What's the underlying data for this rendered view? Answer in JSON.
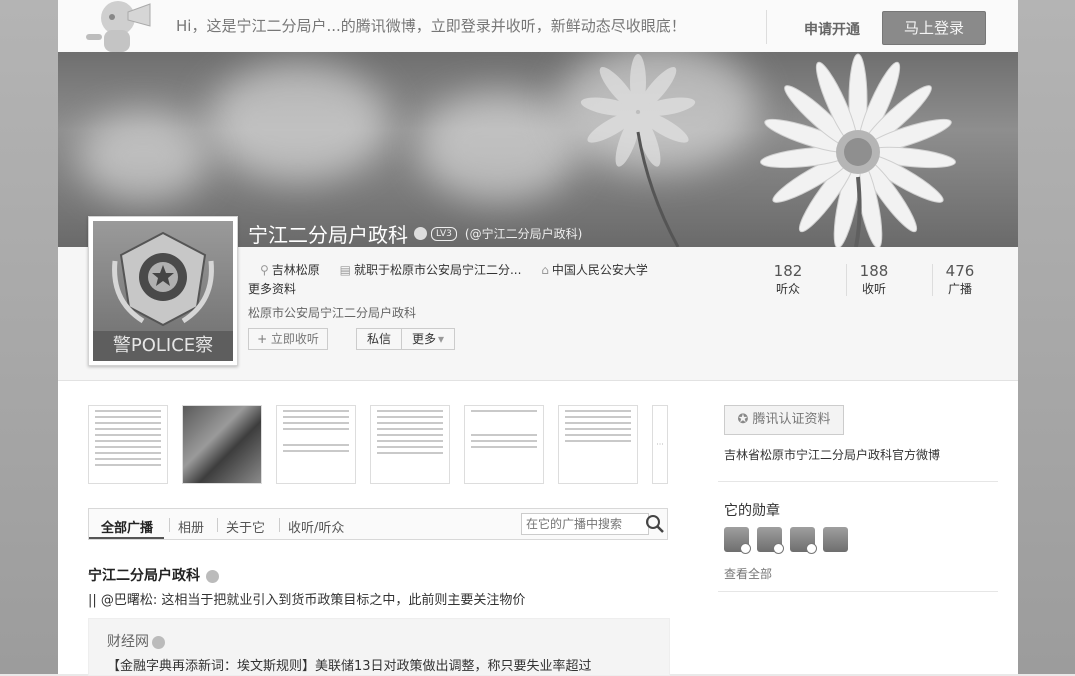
{
  "topbar": {
    "greeting": "Hi，这是宁江二分局户...的腾讯微博，立即登录并收听，新鲜动态尽收眼底！",
    "apply_label": "申请开通",
    "login_label": "马上登录"
  },
  "profile": {
    "name": "宁江二分局户政科",
    "level": "LV3",
    "handle": "(@宁江二分局户政科)",
    "avatar_caption": "警POLICE察",
    "location": "吉林松原",
    "job": "就职于松原市公安局宁江二分...",
    "school": "中国人民公安大学",
    "more_info": "更多资料",
    "description": "松原市公安局宁江二分局户政科",
    "follow_label": "+ 立即收听",
    "message_label": "私信",
    "more_label": "更多"
  },
  "stats": [
    {
      "num": "182",
      "label": "听众"
    },
    {
      "num": "188",
      "label": "收听"
    },
    {
      "num": "476",
      "label": "广播"
    }
  ],
  "tabs": [
    {
      "label": "全部广播",
      "active": true
    },
    {
      "label": "相册"
    },
    {
      "label": "关于它"
    },
    {
      "label": "收听/听众"
    }
  ],
  "search": {
    "placeholder": "在它的广播中搜索"
  },
  "feed": {
    "author": "宁江二分局户政科",
    "text": "|| @巴曙松: 这相当于把就业引入到货币政策目标之中，此前则主要关注物价",
    "quote_author": "财经网",
    "quote_text": "【金融字典再添新词：埃文斯规则】美联储13日对政策做出调整，称只要失业率超过"
  },
  "sidebar": {
    "cert_label": "腾讯认证资料",
    "cert_text": "吉林省松原市宁江二分局户政科官方微博",
    "medals_title": "它的勋章",
    "view_all": "查看全部"
  }
}
